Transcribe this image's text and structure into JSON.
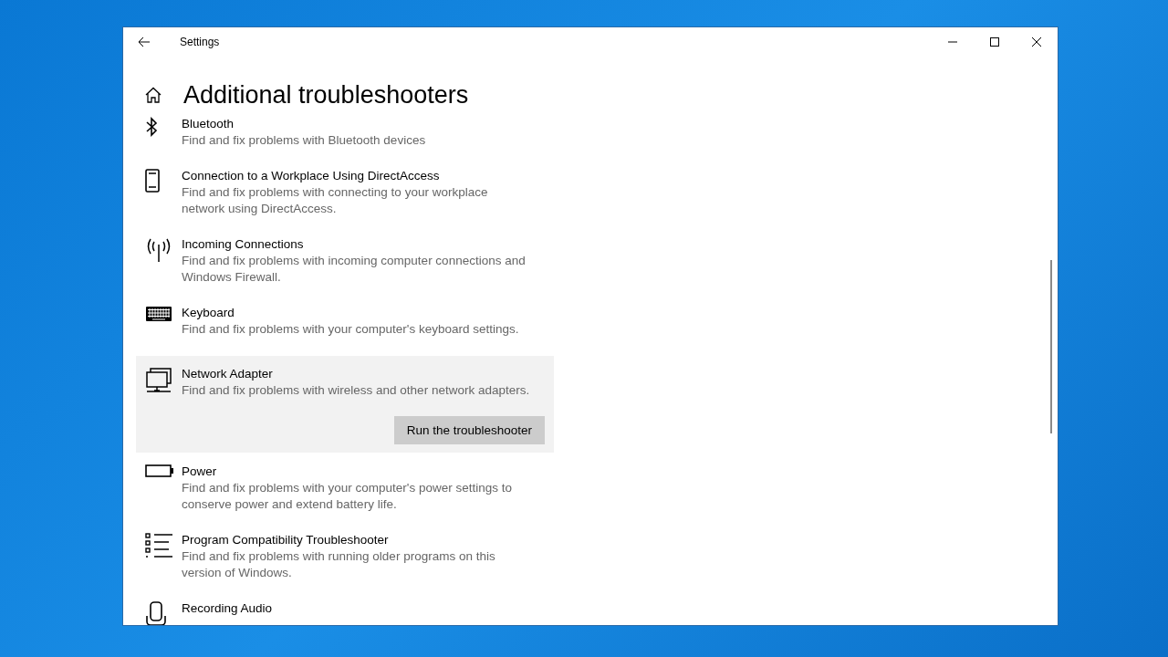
{
  "window": {
    "title": "Settings"
  },
  "page": {
    "heading": "Additional troubleshooters"
  },
  "troubleshooters": [
    {
      "kind": "bluetooth",
      "title": "Bluetooth",
      "description": "Find and fix problems with Bluetooth devices",
      "selected": false
    },
    {
      "kind": "phone",
      "title": "Connection to a Workplace Using DirectAccess",
      "description": "Find and fix problems with connecting to your workplace network using DirectAccess.",
      "selected": false
    },
    {
      "kind": "antenna",
      "title": "Incoming Connections",
      "description": "Find and fix problems with incoming computer connections and Windows Firewall.",
      "selected": false
    },
    {
      "kind": "keyboard",
      "title": "Keyboard",
      "description": "Find and fix problems with your computer's keyboard settings.",
      "selected": false
    },
    {
      "kind": "network",
      "title": "Network Adapter",
      "description": "Find and fix problems with wireless and other network adapters.",
      "selected": true,
      "button": "Run the troubleshooter"
    },
    {
      "kind": "battery",
      "title": "Power",
      "description": "Find and fix problems with your computer's power settings to conserve power and extend battery life.",
      "selected": false
    },
    {
      "kind": "list",
      "title": "Program Compatibility Troubleshooter",
      "description": "Find and fix problems with running older programs on this version of Windows.",
      "selected": false
    },
    {
      "kind": "microphone",
      "title": "Recording Audio",
      "selected": false
    }
  ]
}
